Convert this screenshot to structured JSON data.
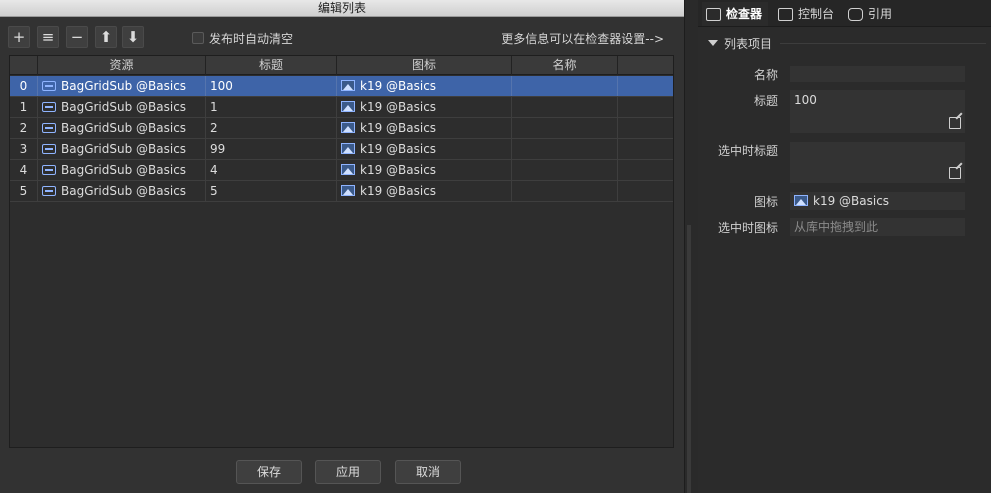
{
  "dialog": {
    "title": "编辑列表",
    "toolbar": {
      "add_glyph": "+",
      "insert_glyph": "≡",
      "remove_glyph": "−",
      "up_glyph": "⬆",
      "down_glyph": "⬇",
      "auto_clear_label": "发布时自动清空",
      "more_info_text": "更多信息可以在检查器设置-->"
    },
    "table": {
      "headers": [
        "资源",
        "标题",
        "图标",
        "名称"
      ],
      "rows": [
        {
          "index": "0",
          "resource": "BagGridSub @Basics",
          "title": "100",
          "icon": "k19 @Basics",
          "name": ""
        },
        {
          "index": "1",
          "resource": "BagGridSub @Basics",
          "title": "1",
          "icon": "k19 @Basics",
          "name": ""
        },
        {
          "index": "2",
          "resource": "BagGridSub @Basics",
          "title": "2",
          "icon": "k19 @Basics",
          "name": ""
        },
        {
          "index": "3",
          "resource": "BagGridSub @Basics",
          "title": "99",
          "icon": "k19 @Basics",
          "name": ""
        },
        {
          "index": "4",
          "resource": "BagGridSub @Basics",
          "title": "4",
          "icon": "k19 @Basics",
          "name": ""
        },
        {
          "index": "5",
          "resource": "BagGridSub @Basics",
          "title": "5",
          "icon": "k19 @Basics",
          "name": ""
        }
      ]
    },
    "buttons": {
      "save": "保存",
      "apply": "应用",
      "cancel": "取消"
    }
  },
  "inspector": {
    "tabs": [
      {
        "label": "检查器",
        "icon": "inspector-icon"
      },
      {
        "label": "控制台",
        "icon": "monitor-icon"
      },
      {
        "label": "引用",
        "icon": "reference-icon"
      }
    ],
    "section_title": "列表项目",
    "props": {
      "name": {
        "label": "名称",
        "value": ""
      },
      "title": {
        "label": "标题",
        "value": "100"
      },
      "selected_title": {
        "label": "选中时标题",
        "value": ""
      },
      "icon": {
        "label": "图标",
        "value": "k19 @Basics"
      },
      "selected_icon": {
        "label": "选中时图标",
        "placeholder": "从库中拖拽到此"
      }
    }
  },
  "colors": {
    "selection": "#3e64a8",
    "panel_bg": "#323232",
    "accent_icon": "#8fb4ff"
  }
}
